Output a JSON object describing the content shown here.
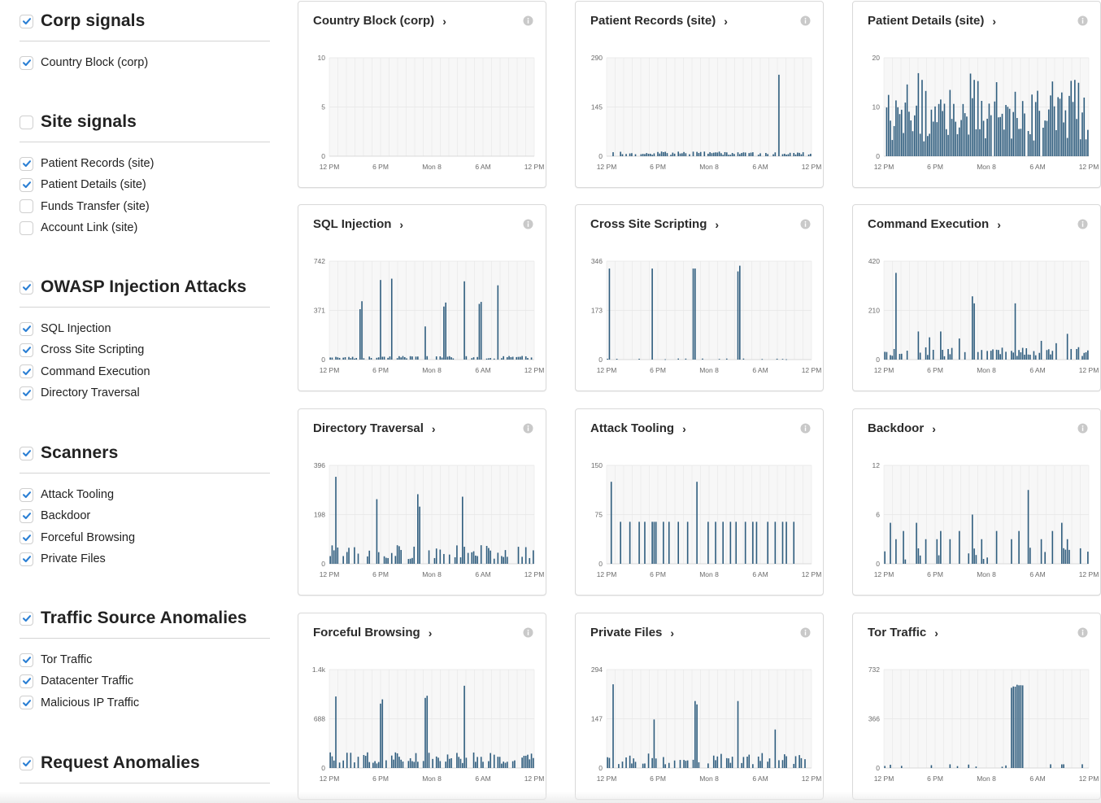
{
  "sidebar": {
    "groups": [
      {
        "title": "Corp signals",
        "checked": true,
        "items": [
          {
            "label": "Country Block (corp)",
            "checked": true
          }
        ]
      },
      {
        "title": "Site signals",
        "checked": false,
        "items": [
          {
            "label": "Patient Records (site)",
            "checked": true
          },
          {
            "label": "Patient Details (site)",
            "checked": true
          },
          {
            "label": "Funds Transfer (site)",
            "checked": false
          },
          {
            "label": "Account Link (site)",
            "checked": false
          }
        ]
      },
      {
        "title": "OWASP Injection Attacks",
        "checked": true,
        "items": [
          {
            "label": "SQL Injection",
            "checked": true
          },
          {
            "label": "Cross Site Scripting",
            "checked": true
          },
          {
            "label": "Command Execution",
            "checked": true
          },
          {
            "label": "Directory Traversal",
            "checked": true
          }
        ]
      },
      {
        "title": "Scanners",
        "checked": true,
        "items": [
          {
            "label": "Attack Tooling",
            "checked": true
          },
          {
            "label": "Backdoor",
            "checked": true
          },
          {
            "label": "Forceful Browsing",
            "checked": true
          },
          {
            "label": "Private Files",
            "checked": true
          }
        ]
      },
      {
        "title": "Traffic Source Anomalies",
        "checked": true,
        "items": [
          {
            "label": "Tor Traffic",
            "checked": true
          },
          {
            "label": "Datacenter Traffic",
            "checked": true
          },
          {
            "label": "Malicious IP Traffic",
            "checked": true
          }
        ]
      },
      {
        "title": "Request Anomalies",
        "checked": true,
        "items": []
      }
    ]
  },
  "colors": {
    "bar": "#2f5d7e",
    "checkbox": "#2a7fd4",
    "grid": "#e6e6e6",
    "plot_bg": "#f7f7f7"
  },
  "x_ticks": [
    "12 PM",
    "6 PM",
    "Mon 8",
    "6 AM",
    "12 PM"
  ],
  "cards": [
    {
      "title": "Country Block (corp)",
      "y_ticks": [
        "10",
        "5",
        "0"
      ],
      "ymax": 10,
      "pattern": "empty"
    },
    {
      "title": "Patient Records (site)",
      "y_ticks": [
        "290",
        "145",
        "0"
      ],
      "ymax": 290,
      "pattern": "records"
    },
    {
      "title": "Patient Details (site)",
      "y_ticks": [
        "20",
        "10",
        "0"
      ],
      "ymax": 20,
      "pattern": "details"
    },
    {
      "title": "SQL Injection",
      "y_ticks": [
        "742",
        "371",
        "0"
      ],
      "ymax": 742,
      "pattern": "sqli"
    },
    {
      "title": "Cross Site Scripting",
      "y_ticks": [
        "346",
        "173",
        "0"
      ],
      "ymax": 346,
      "pattern": "xss"
    },
    {
      "title": "Command Execution",
      "y_ticks": [
        "420",
        "210",
        "0"
      ],
      "ymax": 420,
      "pattern": "cmdexe"
    },
    {
      "title": "Directory Traversal",
      "y_ticks": [
        "396",
        "198",
        "0"
      ],
      "ymax": 396,
      "pattern": "traversal"
    },
    {
      "title": "Attack Tooling",
      "y_ticks": [
        "150",
        "75",
        "0"
      ],
      "ymax": 150,
      "pattern": "tooling"
    },
    {
      "title": "Backdoor",
      "y_ticks": [
        "12",
        "6",
        "0"
      ],
      "ymax": 12,
      "pattern": "backdoor"
    },
    {
      "title": "Forceful Browsing",
      "y_ticks": [
        "1.4k",
        "688",
        "0"
      ],
      "ymax": 1376,
      "pattern": "forceful"
    },
    {
      "title": "Private Files",
      "y_ticks": [
        "294",
        "147",
        "0"
      ],
      "ymax": 294,
      "pattern": "private"
    },
    {
      "title": "Tor Traffic",
      "y_ticks": [
        "732",
        "366",
        "0"
      ],
      "ymax": 732,
      "pattern": "tor"
    }
  ]
}
